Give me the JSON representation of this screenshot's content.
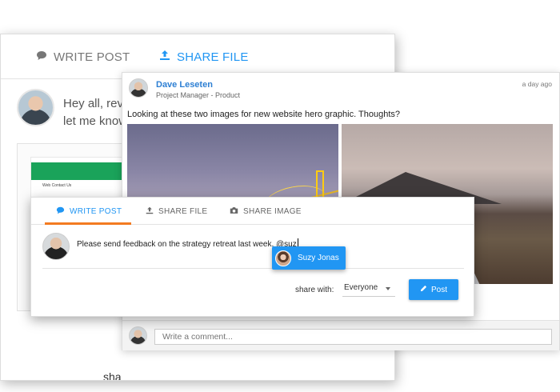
{
  "back_card": {
    "tab_write": "WRITE POST",
    "tab_share": "SHARE FILE",
    "message_line1": "Hey all, revi",
    "message_line2": "let me know",
    "preview_caption": "Web Contact Us",
    "share_fragment": "sha"
  },
  "post": {
    "author": "Dave Leseten",
    "role": "Project Manager - Product",
    "time": "a day ago",
    "message": "Looking at these two images for new website hero graphic. Thoughts?",
    "comment_placeholder": "Write a comment..."
  },
  "composer": {
    "tabs": [
      {
        "label": "WRITE POST",
        "icon": "speech-bubble-icon",
        "active": true
      },
      {
        "label": "SHARE FILE",
        "icon": "upload-icon",
        "active": false
      },
      {
        "label": "SHARE IMAGE",
        "icon": "camera-icon",
        "active": false
      }
    ],
    "text": "Please send feedback on the strategy retreat last week. @suz",
    "share_with_label": "share with:",
    "share_with_value": "Everyone",
    "post_label": "Post"
  },
  "mention": {
    "name": "Suzy Jonas"
  },
  "colors": {
    "accent": "#2196f3",
    "tab_underline": "#f37b21",
    "author_link": "#2d7fd3"
  }
}
